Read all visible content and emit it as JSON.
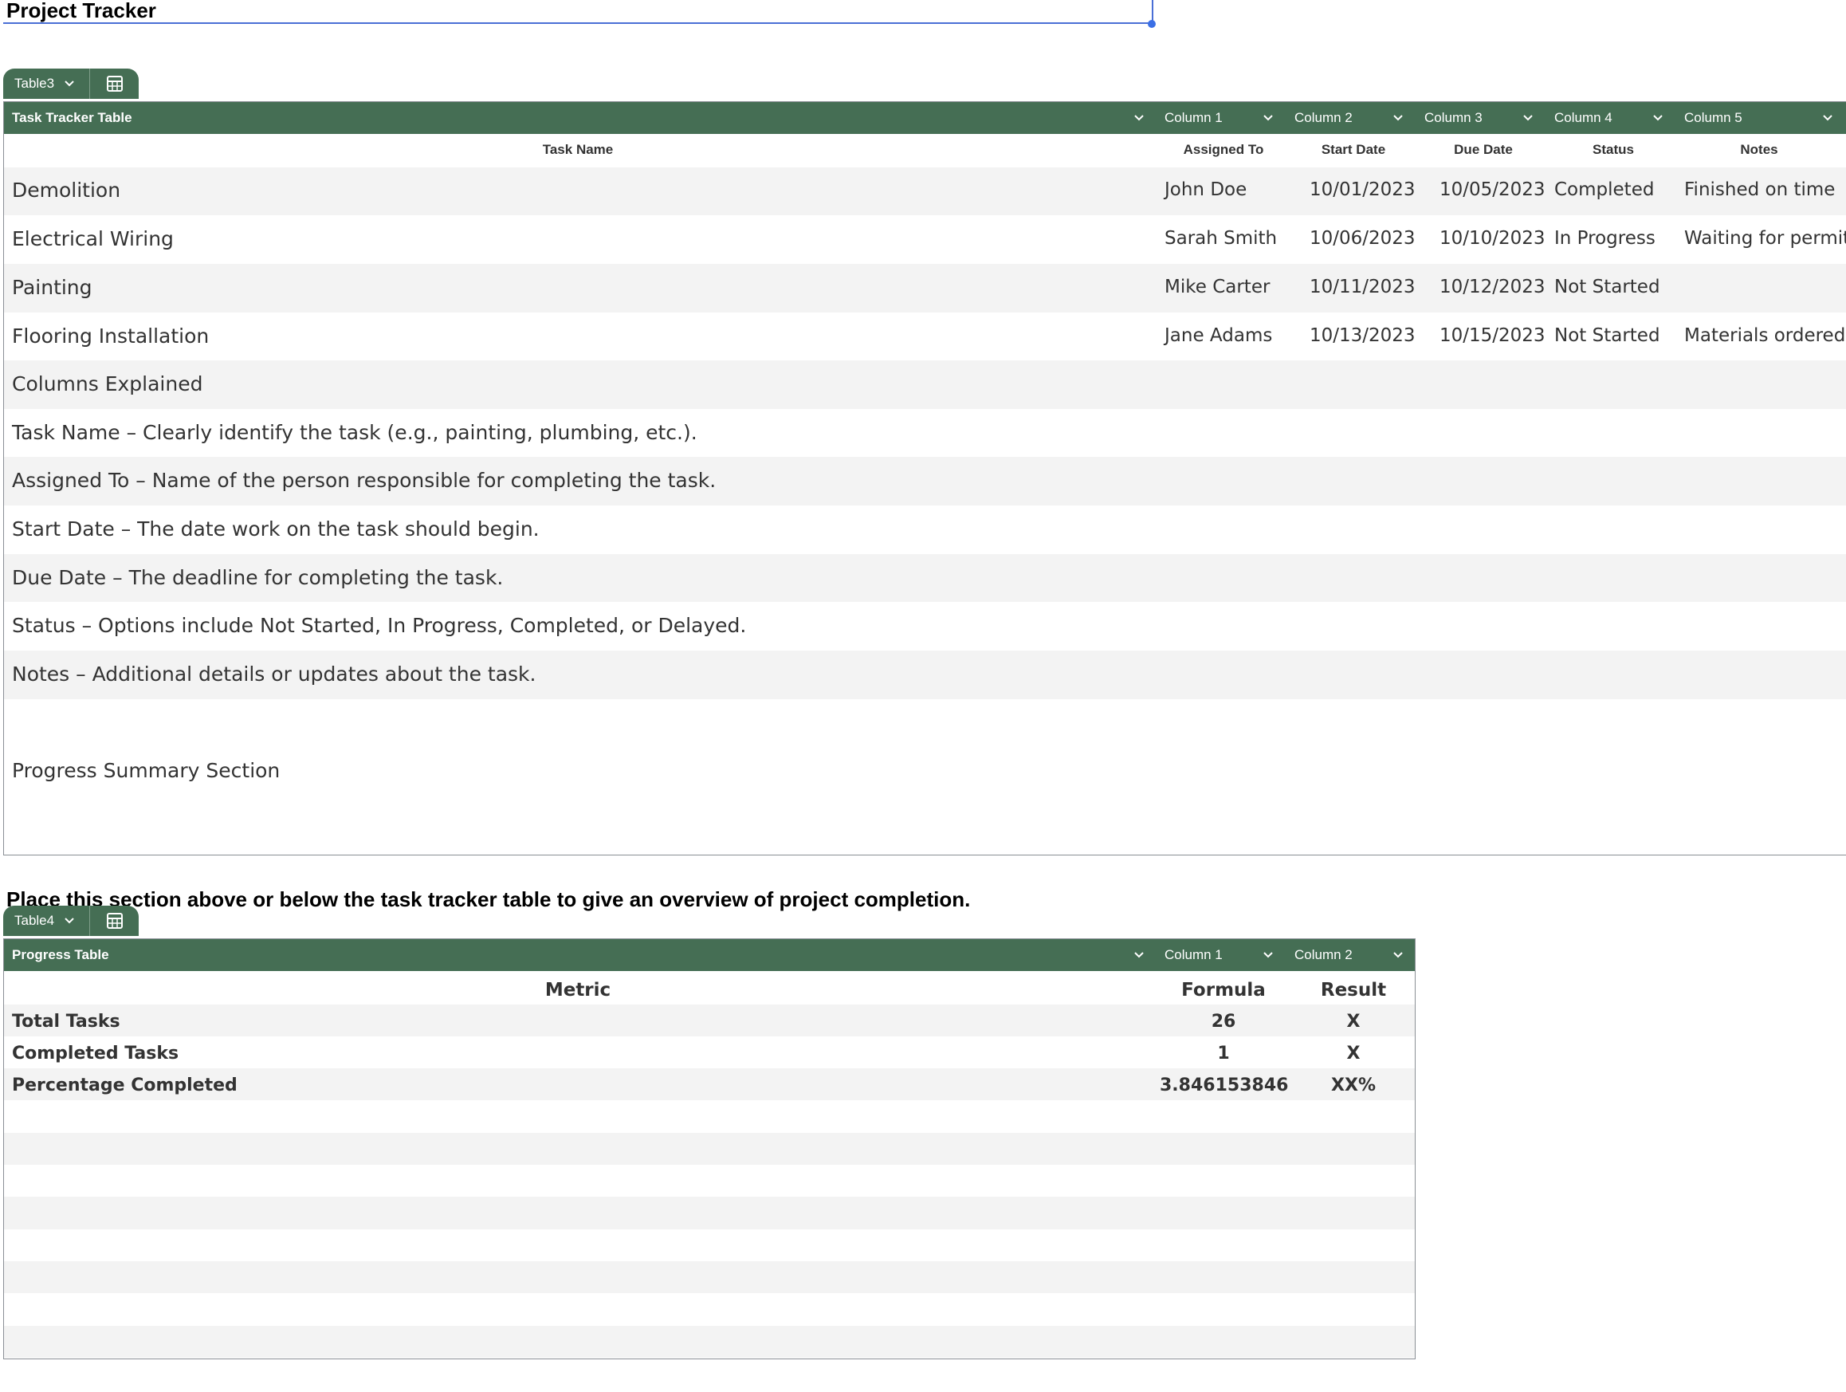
{
  "sheet": {
    "title": "Project Tracker"
  },
  "task_table": {
    "tab_name": "Table3",
    "header_title": "Task Tracker Table",
    "header_columns": [
      "Column 1",
      "Column 2",
      "Column 3",
      "Column 4",
      "Column 5"
    ],
    "col_heads": [
      "Task Name",
      "Assigned To",
      "Start Date",
      "Due Date",
      "Status",
      "Notes"
    ],
    "rows": [
      [
        "Demolition",
        "John Doe",
        "10/01/2023",
        "10/05/2023",
        "Completed",
        "Finished on time"
      ],
      [
        "Electrical Wiring",
        "Sarah Smith",
        "10/06/2023",
        "10/10/2023",
        "In Progress",
        "Waiting for permit"
      ],
      [
        "Painting",
        "Mike Carter",
        "10/11/2023",
        "10/12/2023",
        "Not Started",
        ""
      ],
      [
        "Flooring Installation",
        "Jane Adams",
        "10/13/2023",
        "10/15/2023",
        "Not Started",
        "Materials ordered"
      ]
    ],
    "explain_rows": [
      "Columns Explained",
      "Task Name – Clearly identify the task (e.g., painting, plumbing, etc.).",
      "Assigned To – Name of the person responsible for completing the task.",
      "Start Date – The date work on the task should begin.",
      "Due Date – The deadline for completing the task.",
      "Status – Options include Not Started, In Progress, Completed, or Delayed.",
      "Notes – Additional details or updates about the task."
    ],
    "summary_label": "Progress Summary Section"
  },
  "description": "Place this section above or below the task tracker table to give an overview of project completion.",
  "progress_table": {
    "tab_name": "Table4",
    "header_title": "Progress Table",
    "header_columns": [
      "Column 1",
      "Column 2"
    ],
    "col_heads": [
      "Metric",
      "Formula",
      "Result"
    ],
    "rows": [
      [
        "Total Tasks",
        "26",
        "X"
      ],
      [
        "Completed Tasks",
        "1",
        "X"
      ],
      [
        "Percentage Completed",
        "3.846153846",
        "XX%"
      ]
    ]
  },
  "icons": {
    "dropdown": "chevron-down-icon",
    "table": "table-icon"
  },
  "colors": {
    "header_green": "#456e54",
    "selection_blue": "#4a6fd6"
  }
}
